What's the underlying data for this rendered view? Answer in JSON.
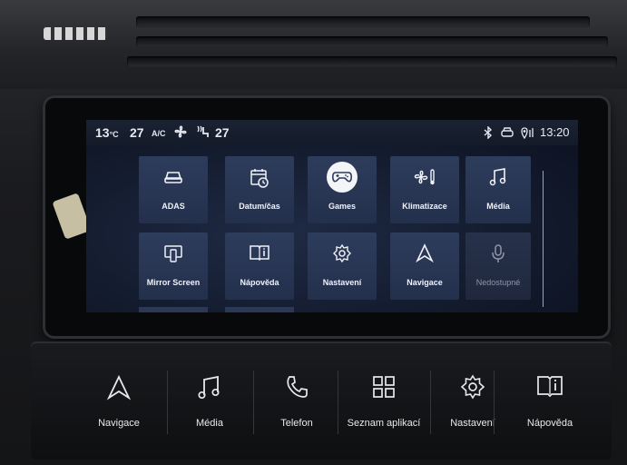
{
  "status_bar": {
    "outside_temp": "13",
    "outside_temp_unit": "°C",
    "driver_temp": "27",
    "ac_label": "A/C",
    "passenger_temp": "27",
    "time": "13:20"
  },
  "apps": [
    {
      "label": "ADAS",
      "icon": "car-icon"
    },
    {
      "label": "Datum/čas",
      "icon": "calendar-clock-icon"
    },
    {
      "label": "Games",
      "icon": "gamepad-icon"
    },
    {
      "label": "Klimatizace",
      "icon": "fan-thermometer-icon"
    },
    {
      "label": "Média",
      "icon": "music-note-icon"
    },
    {
      "label": "Mirror Screen",
      "icon": "mirror-screen-icon"
    },
    {
      "label": "Nápověda",
      "icon": "book-info-icon"
    },
    {
      "label": "Nastavení",
      "icon": "gear-icon"
    },
    {
      "label": "Navigace",
      "icon": "navigation-arrow-icon"
    },
    {
      "label": "Nedostupné",
      "icon": "microphone-icon",
      "disabled": true
    }
  ],
  "shortcuts": [
    {
      "label": "Navigace",
      "icon": "navigation-arrow-icon"
    },
    {
      "label": "Média",
      "icon": "music-note-icon"
    },
    {
      "label": "Telefon",
      "icon": "phone-icon"
    },
    {
      "label": "Seznam aplikací",
      "icon": "app-grid-icon"
    },
    {
      "label": "Nastavení",
      "icon": "gear-icon"
    },
    {
      "label": "Nápověda",
      "icon": "book-info-icon"
    }
  ],
  "colors": {
    "tile": "#2e3c5c",
    "screen_bg": "#121a2c",
    "text": "#f0f2f8"
  }
}
